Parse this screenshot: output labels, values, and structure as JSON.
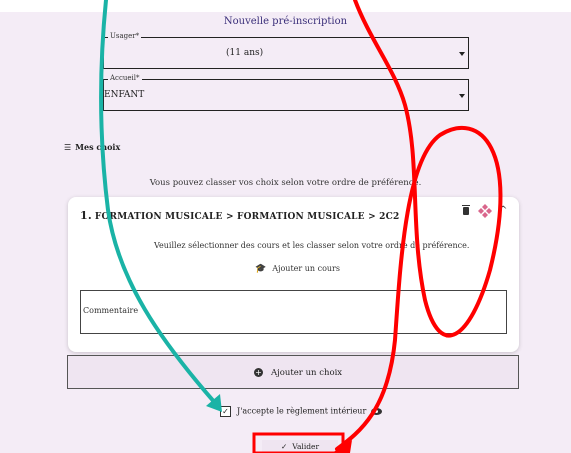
{
  "form": {
    "title": "Nouvelle pré-inscription",
    "usager": {
      "label": "Usager*",
      "value": "(11 ans)"
    },
    "accueil": {
      "label": "Accueil*",
      "value": "ENFANT"
    }
  },
  "choices": {
    "section_title": "Mes choix",
    "hint": "Vous pouvez classer vos choix selon votre ordre de préférence.",
    "items": [
      {
        "number": "1.",
        "path": "FORMATION MUSICALE > FORMATION MUSICALE > 2C2",
        "courses_hint": "Veuillez sélectionner des cours et les classer selon votre ordre de préférence.",
        "add_course_label": "Ajouter un cours",
        "comment_placeholder": "Commentaire"
      }
    ],
    "add_choice_label": "Ajouter un choix"
  },
  "accept_label": "J'accepte le règlement intérieur",
  "submit_label": "Valider",
  "annotation_colors": {
    "teal": "#1ab3a6",
    "red": "#ff0000"
  }
}
